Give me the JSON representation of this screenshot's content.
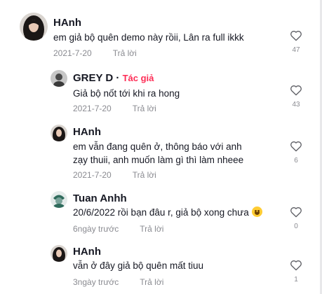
{
  "comments": [
    {
      "name": "HAnh",
      "text": "em giả bộ quên demo này rồii, Lân ra full ikkk",
      "date": "2021-7-20",
      "reply_label": "Trả lời",
      "likes": "47"
    },
    {
      "name": "GREY D",
      "dot": " · ",
      "author_tag": "Tác giả",
      "text": "Giả bộ nốt tới khi ra hong",
      "date": "2021-7-20",
      "reply_label": "Trả lời",
      "likes": "43"
    },
    {
      "name": "HAnh",
      "text": "em vẫn đang quên ở, thông báo với anh zạy thuii, anh muốn làm gì thì làm nheee",
      "date": "2021-7-20",
      "reply_label": "Trả lời",
      "likes": "6"
    },
    {
      "name": "Tuan Anhh",
      "text": "20/6/2022 rồi bạn đâu r, giả bộ xong chưa",
      "emoji": "laughing-emoji",
      "date": "6ngày trước",
      "reply_label": "Trả lời",
      "likes": "0"
    },
    {
      "name": "HAnh",
      "text": "vẫn ở đây giả bộ quên mất tiuu",
      "date": "3ngày trước",
      "reply_label": "Trả lời",
      "likes": "1"
    }
  ],
  "icons": {
    "like": "heart-outline-icon"
  },
  "colors": {
    "author_tag": "#fe2c55",
    "meta": "#8a8b91",
    "text": "#161823"
  }
}
